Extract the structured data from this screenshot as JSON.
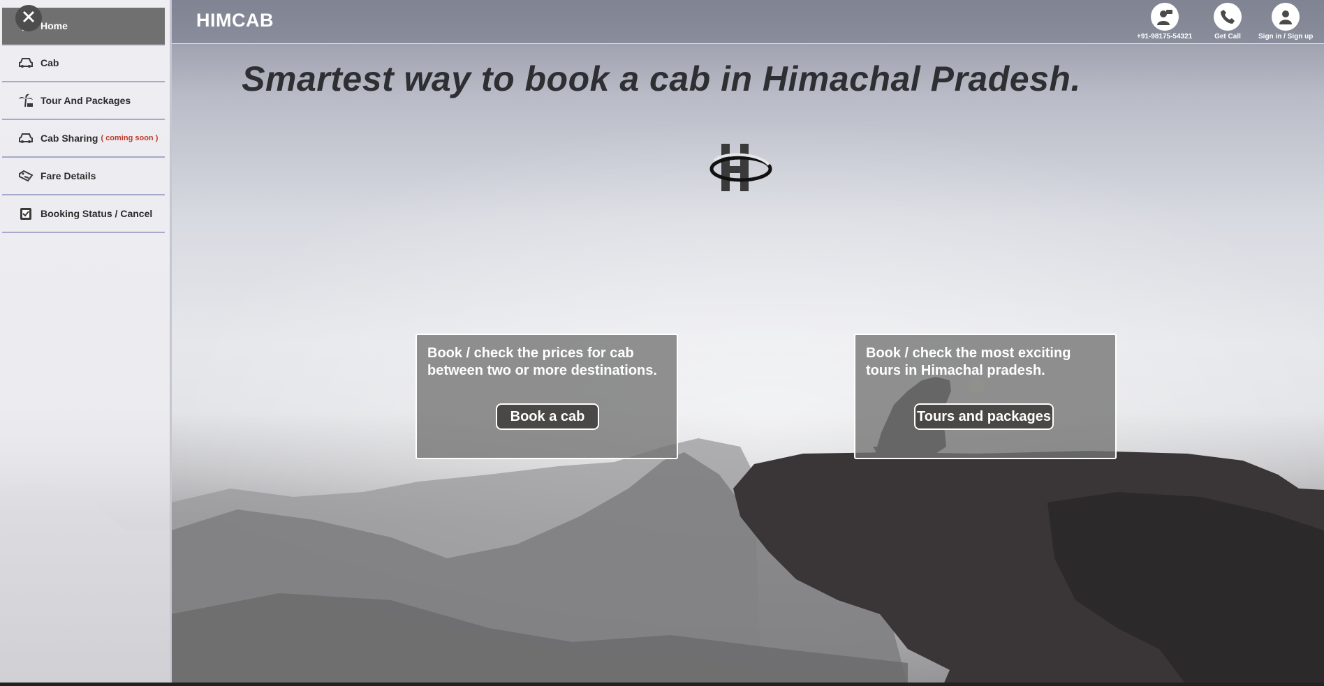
{
  "brand": "HIMCAB",
  "headline": "Smartest way to book a cab in Himachal Pradesh.",
  "top_actions": [
    {
      "label": "+91-98175-54321",
      "icon": "support-agent-icon"
    },
    {
      "label": "Get Call",
      "icon": "phone-icon"
    },
    {
      "label": "Sign in / Sign up",
      "icon": "user-icon"
    }
  ],
  "sidebar": {
    "items": [
      {
        "label": "Home",
        "icon": "home-icon",
        "active": true
      },
      {
        "label": "Cab",
        "icon": "car-icon"
      },
      {
        "label": "Tour And Packages",
        "icon": "palm-tree-icon"
      },
      {
        "label": "Cab Sharing",
        "badge": "( coming soon )",
        "icon": "car-icon"
      },
      {
        "label": "Fare Details",
        "icon": "price-tag-icon"
      },
      {
        "label": "Booking Status / Cancel",
        "icon": "checklist-icon"
      }
    ]
  },
  "cards": [
    {
      "text": "Book / check the prices for cab between two or more destinations.",
      "button": "Book a cab"
    },
    {
      "text": "Book / check the most exciting tours in Himachal pradesh.",
      "button": "Tours and packages"
    }
  ],
  "colors": {
    "accent_dark": "#4a4846",
    "menu_active": "#707070",
    "divider": "#a7a8cc",
    "coming_soon": "#c0392b"
  }
}
